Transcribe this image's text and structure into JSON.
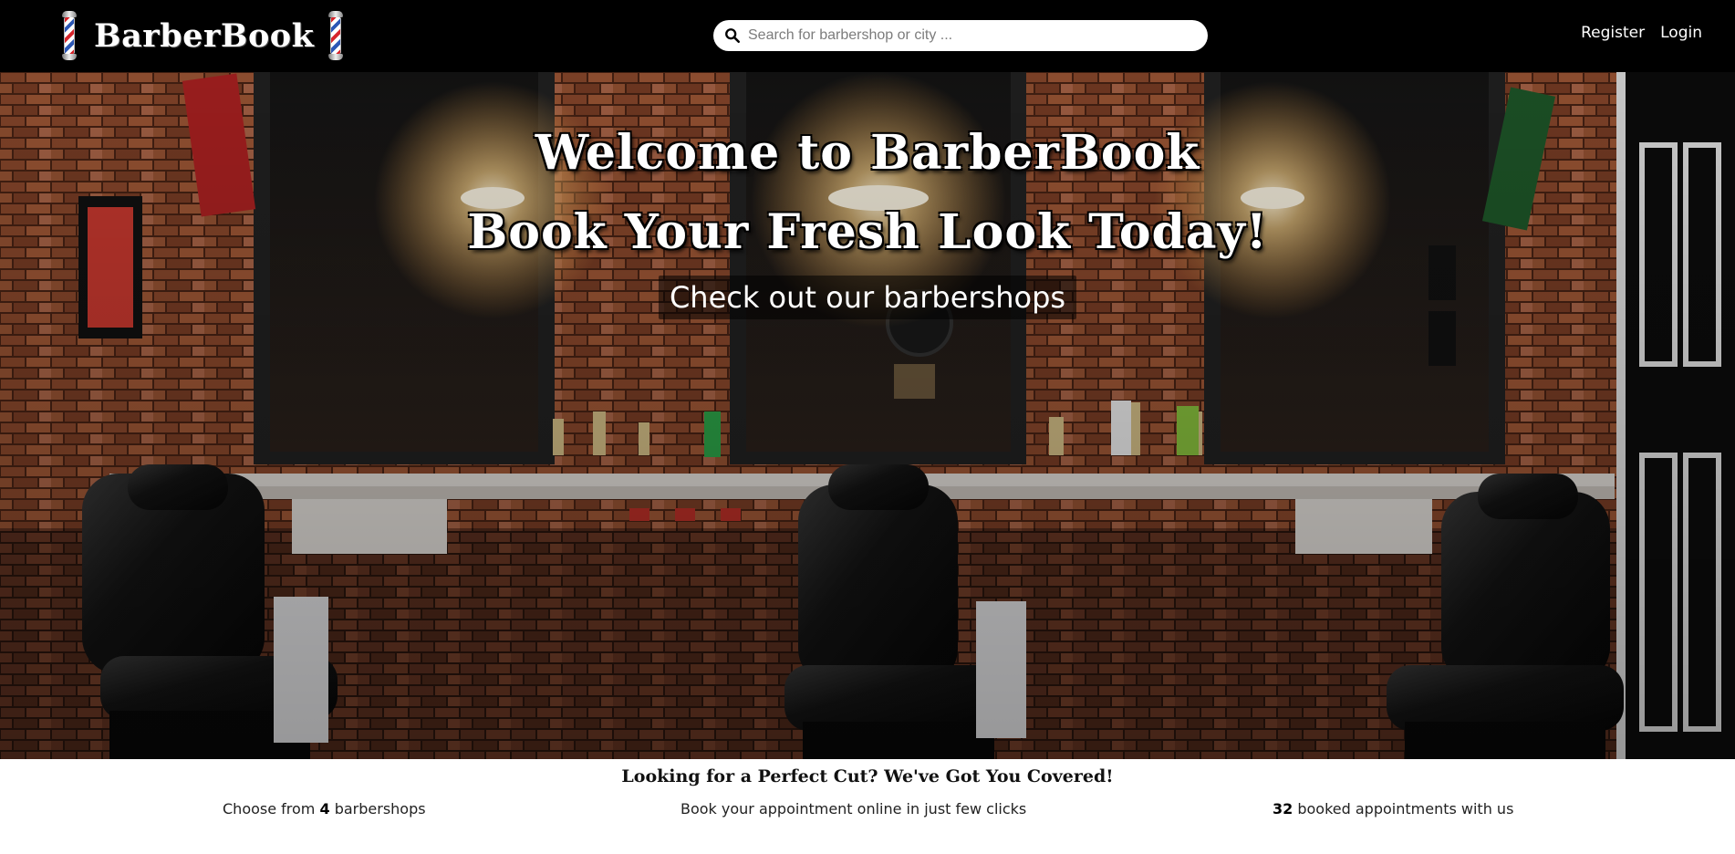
{
  "navbar": {
    "brand": "BarberBook",
    "search_placeholder": "Search for barbershop or city ...",
    "links": [
      "Register",
      "Login"
    ]
  },
  "hero": {
    "title": "Welcome to BarberBook",
    "subtitle": "Book Your Fresh Look Today!",
    "cta": "Check out our barbershops",
    "image": "barbershop interior with three black leather barber chairs, brick walls, mirrors and hanging lamps"
  },
  "features": {
    "title": "Looking for a Perfect Cut? We've Got You Covered!",
    "barbershops_prefix": "Choose from ",
    "barbershops_count": "4",
    "barbershops_suffix": " barbershops",
    "online_booking": "Book your appointment online in just few clicks",
    "appointments_count": "32",
    "appointments_suffix": " booked appointments with us"
  },
  "icons": {
    "search": "search-icon",
    "logo_left": "barber-pole-icon",
    "logo_right": "barber-pole-icon"
  },
  "colors": {
    "navbar_bg": "#000000",
    "text_light": "#ffffff",
    "pole_red": "#d6242b",
    "pole_blue": "#2c57b5"
  }
}
